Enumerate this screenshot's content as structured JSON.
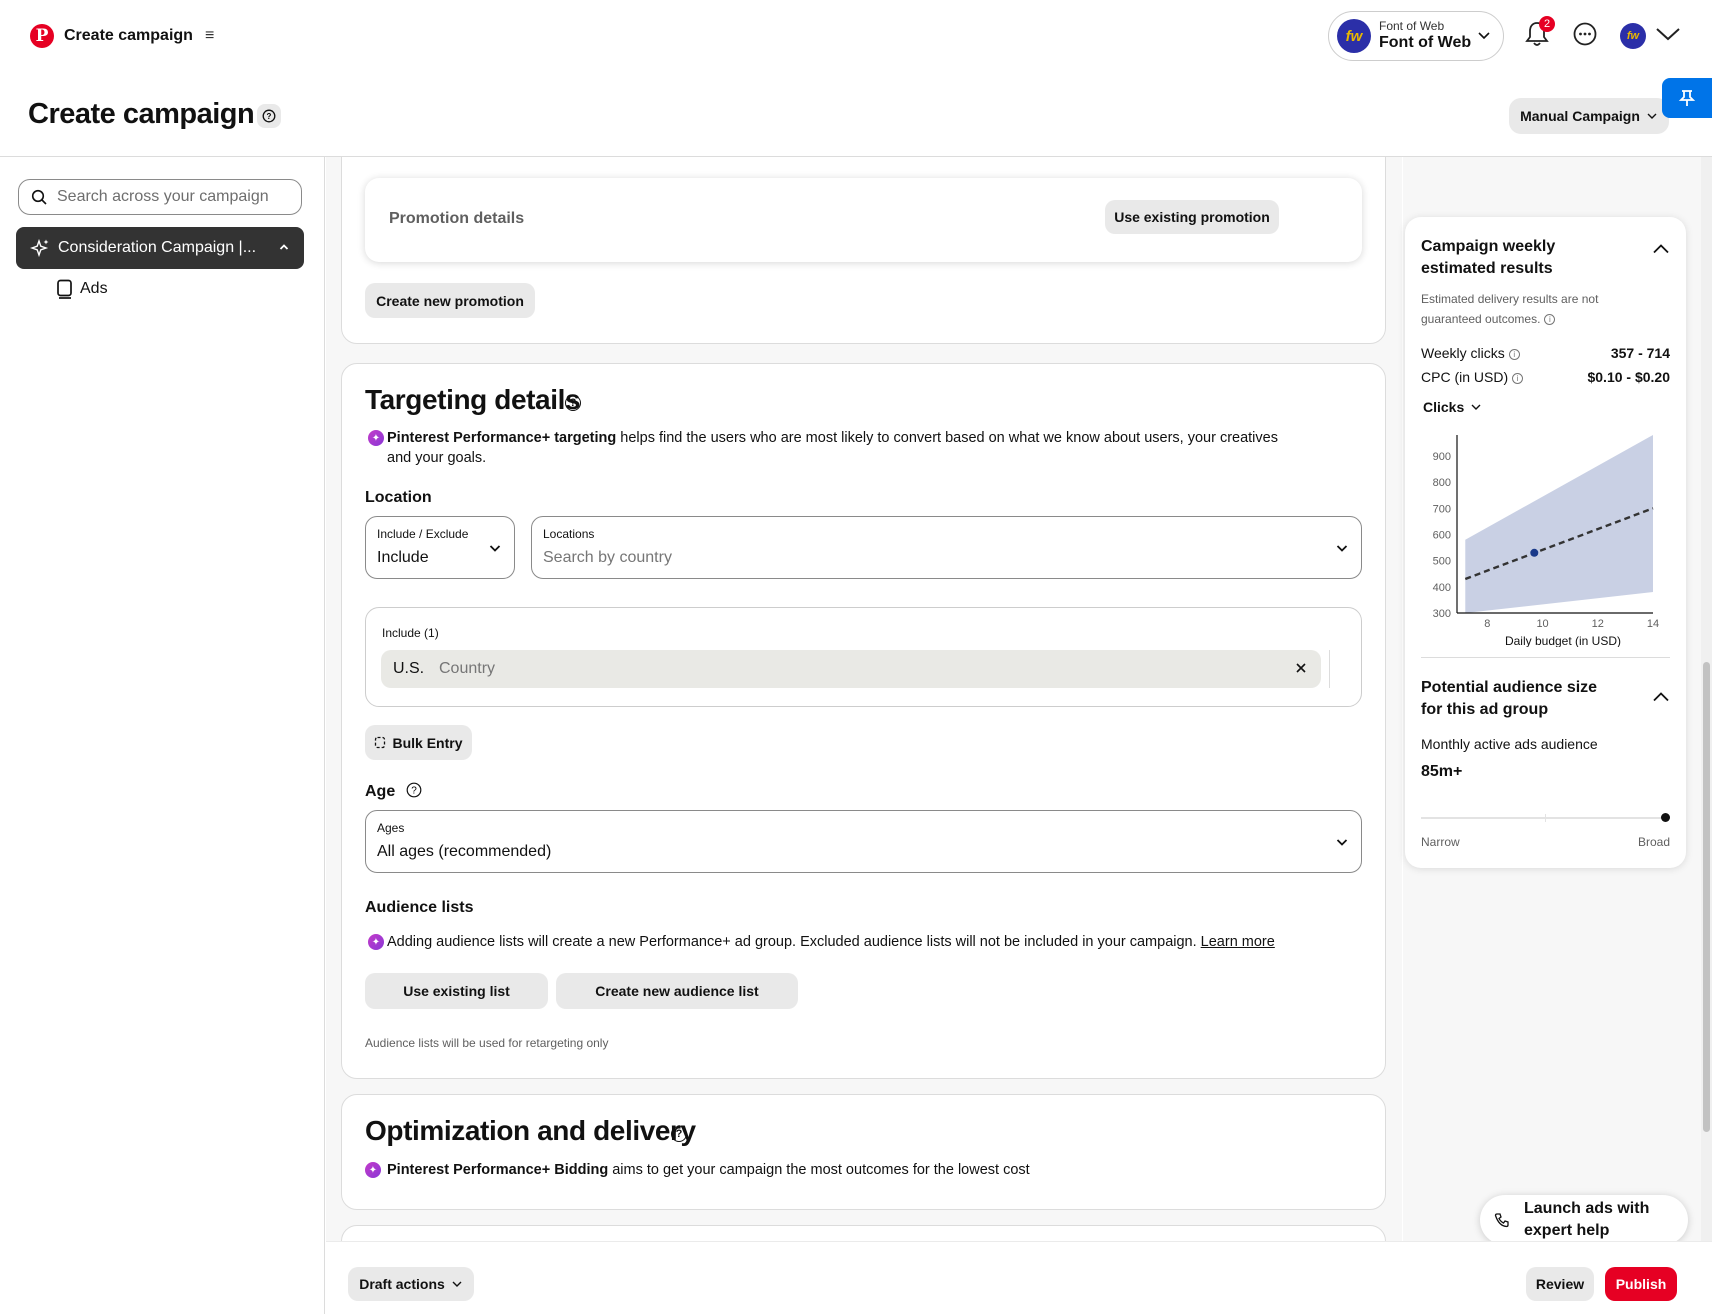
{
  "topbar": {
    "logo_letter": "P",
    "title": "Create campaign",
    "menu_glyph": "≡",
    "account_small": "Font of Web",
    "account_name": "Font of Web",
    "avatar_initials": "fw",
    "notification_count": "2"
  },
  "header": {
    "title": "Create campaign",
    "campaign_mode": "Manual Campaign"
  },
  "sidebar": {
    "search_placeholder": "Search across your campaign",
    "campaign_item": "Consideration Campaign |...",
    "ads_item": "Ads"
  },
  "promotion": {
    "title": "Promotion details",
    "use_existing": "Use existing promotion",
    "create_new": "Create new promotion"
  },
  "targeting": {
    "title": "Targeting details",
    "perf_bold": "Pinterest Performance+ targeting",
    "perf_rest": " helps find the users who are most likely to convert based on what we know about users, your creatives and your goals.",
    "location_label": "Location",
    "include_exclude_label": "Include / Exclude",
    "include_exclude_value": "Include",
    "locations_label": "Locations",
    "locations_placeholder": "Search by country",
    "include_list_label": "Include (1)",
    "chip_name": "U.S.",
    "chip_type": "Country",
    "bulk_entry": "Bulk Entry",
    "age_label": "Age",
    "ages_field_label": "Ages",
    "ages_value": "All ages (recommended)",
    "audience_label": "Audience lists",
    "audience_note": "Adding audience lists will create a new Performance+ ad group. Excluded audience lists will not be included in your campaign. ",
    "learn_more": "Learn more",
    "use_existing_list": "Use existing list",
    "create_new_list": "Create new audience list",
    "retargeting_note": "Audience lists will be used for retargeting only"
  },
  "optimization": {
    "title": "Optimization and delivery",
    "bidding_bold": "Pinterest Performance+ Bidding",
    "bidding_rest": " aims to get your campaign the most outcomes for the lowest cost"
  },
  "footer": {
    "draft_actions": "Draft actions",
    "review": "Review",
    "publish": "Publish"
  },
  "estimates": {
    "title": "Campaign weekly estimated results",
    "note": "Estimated delivery results are not guaranteed outcomes.",
    "weekly_clicks_label": "Weekly clicks",
    "weekly_clicks_value": "357 - 714",
    "cpc_label": "CPC (in USD)",
    "cpc_value": "$0.10 - $0.20",
    "metric_dropdown": "Clicks"
  },
  "chart_data": {
    "type": "line",
    "xlabel": "Daily budget (in USD)",
    "ylabel": "",
    "x_ticks": [
      8,
      10,
      12,
      14
    ],
    "y_ticks": [
      300,
      400,
      500,
      600,
      700,
      800,
      900
    ],
    "xlim": [
      6.9,
      14
    ],
    "ylim": [
      300,
      980
    ],
    "series": [
      {
        "x": [
          7.2,
          14
        ],
        "y": [
          430,
          700
        ]
      }
    ],
    "band": {
      "x": [
        7.2,
        14
      ],
      "low": [
        300,
        380
      ],
      "high": [
        580,
        980
      ]
    },
    "current_point": {
      "x": 9.7,
      "y": 530
    },
    "colors": {
      "band": "#c9d0e4",
      "line": "#333333",
      "point": "#1a3a8a"
    }
  },
  "audience": {
    "title": "Potential audience size for this ad group",
    "subtitle": "Monthly active ads audience",
    "value": "85m+",
    "slider_value": 1.0,
    "narrow": "Narrow",
    "broad": "Broad"
  },
  "help_float": {
    "text": "Launch ads with expert help"
  }
}
